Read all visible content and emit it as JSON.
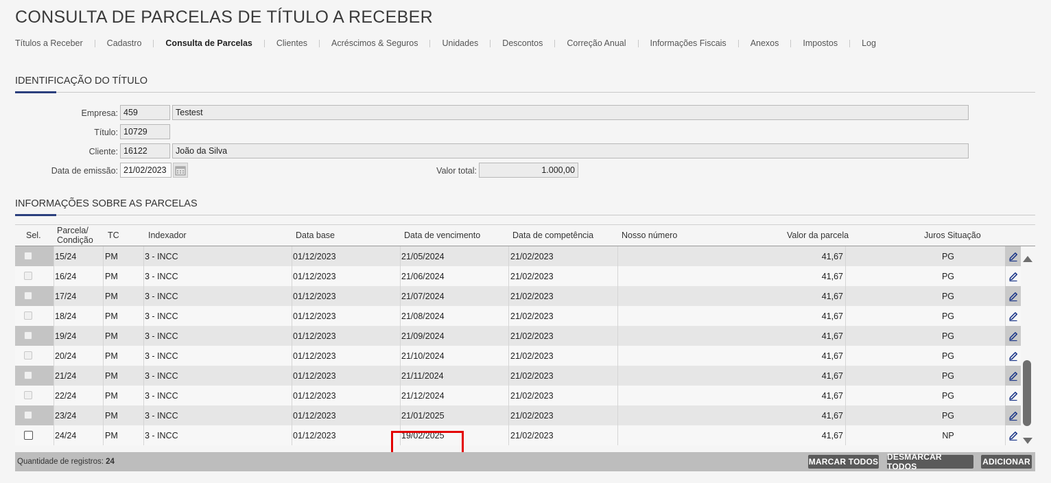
{
  "page_title": "CONSULTA DE PARCELAS DE TÍTULO A RECEBER",
  "nav": [
    {
      "label": "Títulos a Receber",
      "active": false
    },
    {
      "label": "Cadastro",
      "active": false
    },
    {
      "label": "Consulta de Parcelas",
      "active": true
    },
    {
      "label": "Clientes",
      "active": false
    },
    {
      "label": "Acréscimos & Seguros",
      "active": false
    },
    {
      "label": "Unidades",
      "active": false
    },
    {
      "label": "Descontos",
      "active": false
    },
    {
      "label": "Correção Anual",
      "active": false
    },
    {
      "label": "Informações Fiscais",
      "active": false
    },
    {
      "label": "Anexos",
      "active": false
    },
    {
      "label": "Impostos",
      "active": false
    },
    {
      "label": "Log",
      "active": false
    }
  ],
  "identificacao": {
    "title": "IDENTIFICAÇÃO DO TÍTULO",
    "empresa_label": "Empresa:",
    "empresa_code": "459",
    "empresa_name": "Testest",
    "titulo_label": "Título:",
    "titulo_value": "10729",
    "cliente_label": "Cliente:",
    "cliente_code": "16122",
    "cliente_name": "João da Silva",
    "data_emissao_label": "Data de emissão:",
    "data_emissao_value": "21/02/2023",
    "valor_total_label": "Valor total:",
    "valor_total_value": "1.000,00"
  },
  "parcelas": {
    "title": "INFORMAÇÕES SOBRE AS PARCELAS",
    "columns": {
      "sel": "Sel.",
      "parcela_1": "Parcela/",
      "parcela_2": "Condição",
      "tc": "TC",
      "indexador": "Indexador",
      "data_base": "Data base",
      "data_vencimento": "Data de vencimento",
      "data_competencia": "Data de competência",
      "nosso_numero": "Nosso número",
      "valor_parcela": "Valor da parcela",
      "juros_situacao": "Juros Situação"
    },
    "rows": [
      {
        "parcela": "15/24",
        "tc": "PM",
        "indexador": "3 - INCC",
        "data_base": "01/12/2023",
        "vencimento": "21/05/2024",
        "competencia": "21/02/2023",
        "nosso_numero": "",
        "valor": "41,67",
        "situacao": "PG"
      },
      {
        "parcela": "16/24",
        "tc": "PM",
        "indexador": "3 - INCC",
        "data_base": "01/12/2023",
        "vencimento": "21/06/2024",
        "competencia": "21/02/2023",
        "nosso_numero": "",
        "valor": "41,67",
        "situacao": "PG"
      },
      {
        "parcela": "17/24",
        "tc": "PM",
        "indexador": "3 - INCC",
        "data_base": "01/12/2023",
        "vencimento": "21/07/2024",
        "competencia": "21/02/2023",
        "nosso_numero": "",
        "valor": "41,67",
        "situacao": "PG"
      },
      {
        "parcela": "18/24",
        "tc": "PM",
        "indexador": "3 - INCC",
        "data_base": "01/12/2023",
        "vencimento": "21/08/2024",
        "competencia": "21/02/2023",
        "nosso_numero": "",
        "valor": "41,67",
        "situacao": "PG"
      },
      {
        "parcela": "19/24",
        "tc": "PM",
        "indexador": "3 - INCC",
        "data_base": "01/12/2023",
        "vencimento": "21/09/2024",
        "competencia": "21/02/2023",
        "nosso_numero": "",
        "valor": "41,67",
        "situacao": "PG"
      },
      {
        "parcela": "20/24",
        "tc": "PM",
        "indexador": "3 - INCC",
        "data_base": "01/12/2023",
        "vencimento": "21/10/2024",
        "competencia": "21/02/2023",
        "nosso_numero": "",
        "valor": "41,67",
        "situacao": "PG"
      },
      {
        "parcela": "21/24",
        "tc": "PM",
        "indexador": "3 - INCC",
        "data_base": "01/12/2023",
        "vencimento": "21/11/2024",
        "competencia": "21/02/2023",
        "nosso_numero": "",
        "valor": "41,67",
        "situacao": "PG"
      },
      {
        "parcela": "22/24",
        "tc": "PM",
        "indexador": "3 - INCC",
        "data_base": "01/12/2023",
        "vencimento": "21/12/2024",
        "competencia": "21/02/2023",
        "nosso_numero": "",
        "valor": "41,67",
        "situacao": "PG"
      },
      {
        "parcela": "23/24",
        "tc": "PM",
        "indexador": "3 - INCC",
        "data_base": "01/12/2023",
        "vencimento": "21/01/2025",
        "competencia": "21/02/2023",
        "nosso_numero": "",
        "valor": "41,67",
        "situacao": "PG"
      },
      {
        "parcela": "24/24",
        "tc": "PM",
        "indexador": "3 - INCC",
        "data_base": "01/12/2023",
        "vencimento": "19/02/2025",
        "competencia": "21/02/2023",
        "nosso_numero": "",
        "valor": "41,67",
        "situacao": "NP"
      }
    ],
    "row_icon": "pencil-edit-icon"
  },
  "footer": {
    "count_label": "Quantidade de registros:",
    "count_value": "24",
    "marcar_todos": "MARCAR TODOS",
    "desmarcar_todos": "DESMARCAR TODOS",
    "adicionar": "ADICIONAR"
  },
  "colors": {
    "accent": "#2b3f7d",
    "highlight": "#e30000",
    "button_bg": "#5a5a5a"
  }
}
